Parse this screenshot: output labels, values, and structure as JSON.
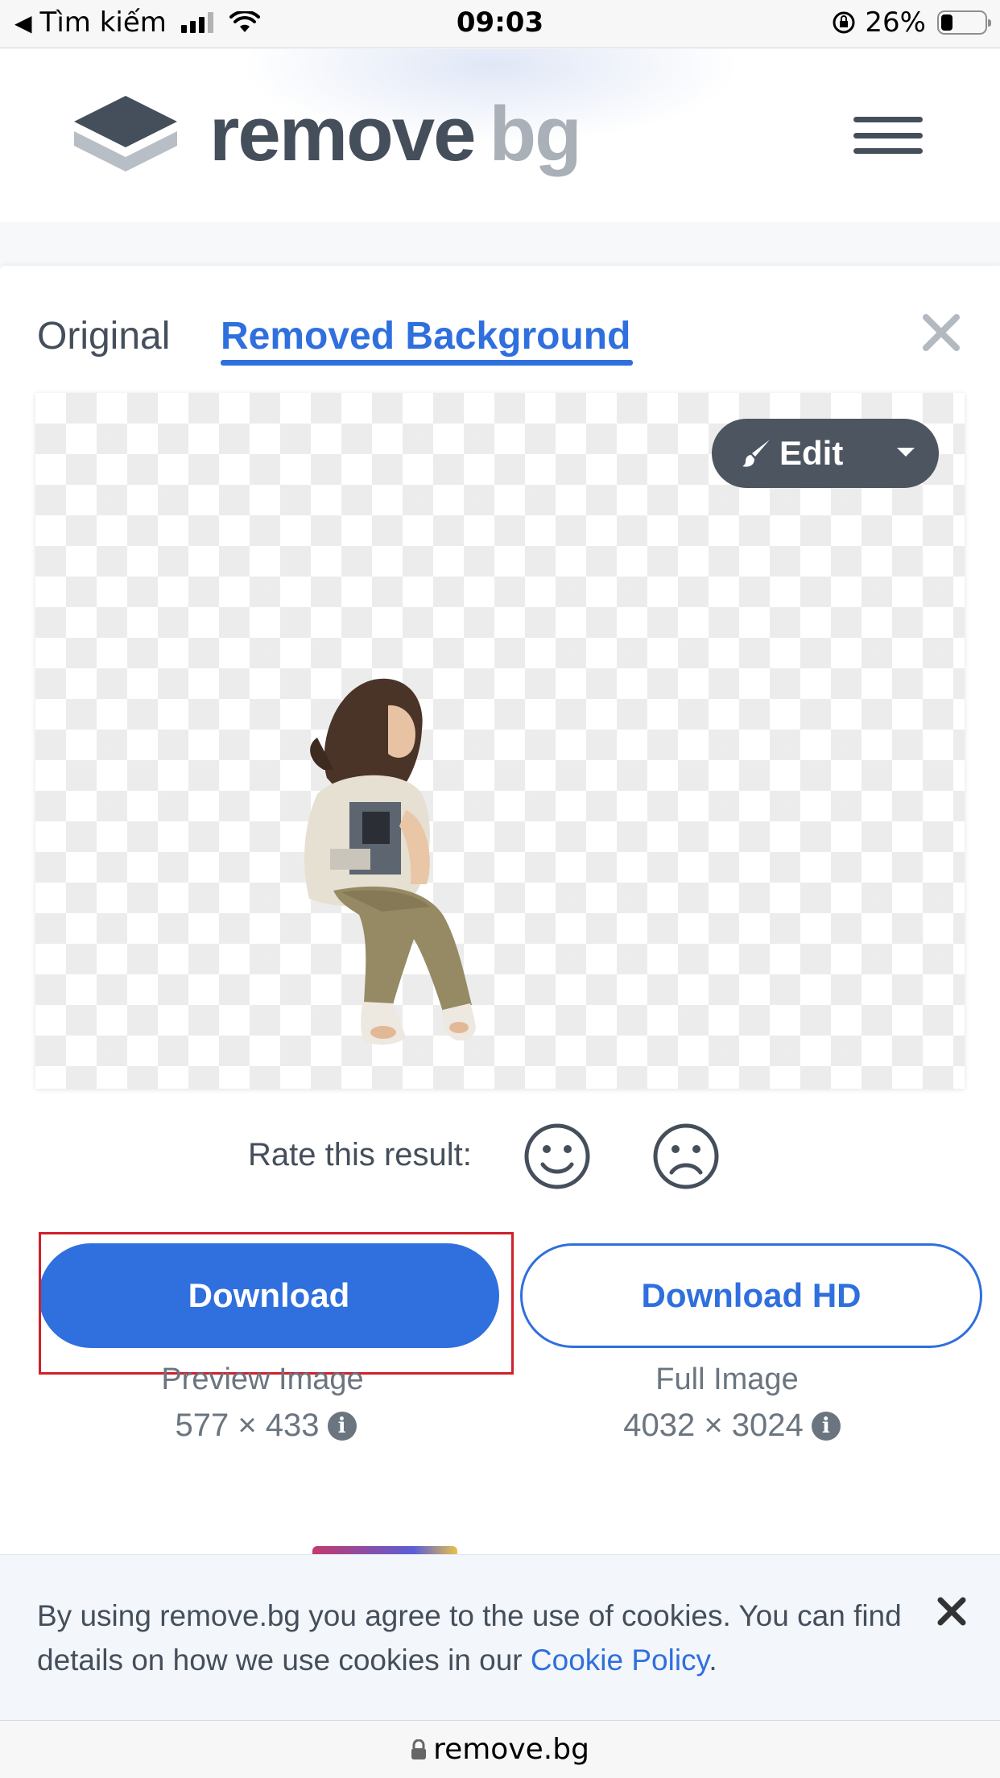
{
  "status_bar": {
    "back_label": "Tìm kiếm",
    "time": "09:03",
    "battery": "26%",
    "battery_level": 0.26
  },
  "header": {
    "logo_word_1": "remove",
    "logo_word_2": "bg"
  },
  "tabs": [
    {
      "label": "Original",
      "active": false
    },
    {
      "label": "Removed Background",
      "active": true
    }
  ],
  "preview": {
    "edit_label": "Edit"
  },
  "rating": {
    "label": "Rate this result:"
  },
  "downloads": {
    "download_label": "Download",
    "download_hd_label": "Download HD",
    "preview_caption": "Preview Image",
    "preview_dims": "577 × 433",
    "full_caption": "Full Image",
    "full_dims": "4032 × 3024"
  },
  "cookie": {
    "text_before": "By using remove.bg you agree to the use of cookies. You can find details on how we use cookies in our ",
    "link": "Cookie Policy",
    "text_after": "."
  },
  "url_bar": {
    "domain": "remove.bg"
  },
  "colors": {
    "accent": "#2f6fde",
    "text": "#454f5b",
    "highlight": "#d0202a"
  }
}
